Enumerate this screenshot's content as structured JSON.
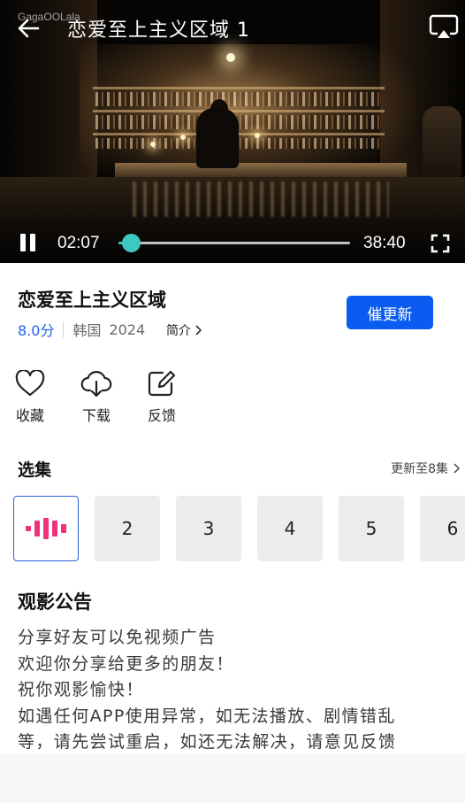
{
  "player": {
    "watermark": "GagaOOLala",
    "title": "恋爱至上主义区域 1",
    "current_time": "02:07",
    "duration": "38:40",
    "progress_fraction": 0.055,
    "accent_color": "#3cc9c2",
    "icons": {
      "back": "back-arrow-icon",
      "cast": "screen-cast-icon",
      "pause": "pause-icon",
      "fullscreen": "fullscreen-icon"
    }
  },
  "show": {
    "title": "恋爱至上主义区域",
    "rating": "8.0分",
    "region": "韩国",
    "year": "2024",
    "intro_label": "简介",
    "urge_update_label": "催更新",
    "brand_color": "#0a5cf0"
  },
  "actions": [
    {
      "name": "favorite",
      "icon": "heart-icon",
      "label": "收藏"
    },
    {
      "name": "download",
      "icon": "cloud-download-icon",
      "label": "下载"
    },
    {
      "name": "feedback",
      "icon": "edit-icon",
      "label": "反馈"
    }
  ],
  "episodes": {
    "heading": "选集",
    "update_status": "更新至8集",
    "playing_indicator_color": "#f0327a",
    "items": [
      {
        "label": "",
        "playing": true
      },
      {
        "label": "2",
        "playing": false
      },
      {
        "label": "3",
        "playing": false
      },
      {
        "label": "4",
        "playing": false
      },
      {
        "label": "5",
        "playing": false
      },
      {
        "label": "6",
        "playing": false
      }
    ]
  },
  "notice": {
    "title": "观影公告",
    "lines": [
      "分享好友可以免视频广告",
      "欢迎你分享给更多的朋友！",
      "祝你观影愉快！",
      "如遇任何APP使用异常，如无法播放、剧情错乱",
      "等，请先尝试重启，如还无法解决，请意见反馈"
    ]
  }
}
